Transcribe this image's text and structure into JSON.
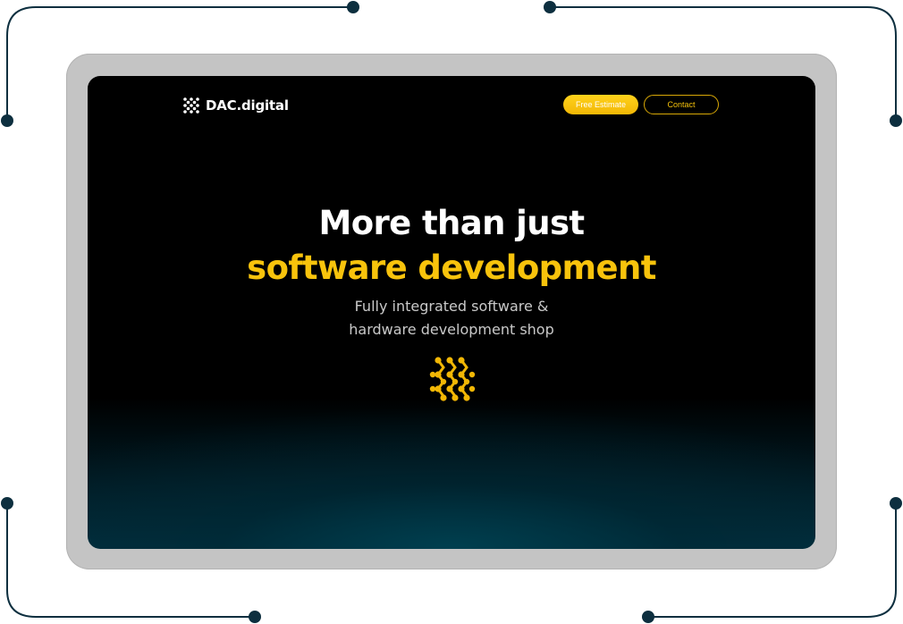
{
  "brand": {
    "name": "DAC.digital",
    "logo_icon": "dac-logo-icon",
    "accent_color": "#f8c30c",
    "background_color": "#000000",
    "glow_color": "#013040"
  },
  "nav": {
    "estimate_label": "Free Estimate",
    "contact_label": "Contact"
  },
  "hero": {
    "title_line1": "More than just",
    "title_line2": "software development",
    "subtitle_line1": "Fully integrated software &",
    "subtitle_line2": "hardware development shop",
    "mark_icon": "dac-network-mark-icon"
  }
}
